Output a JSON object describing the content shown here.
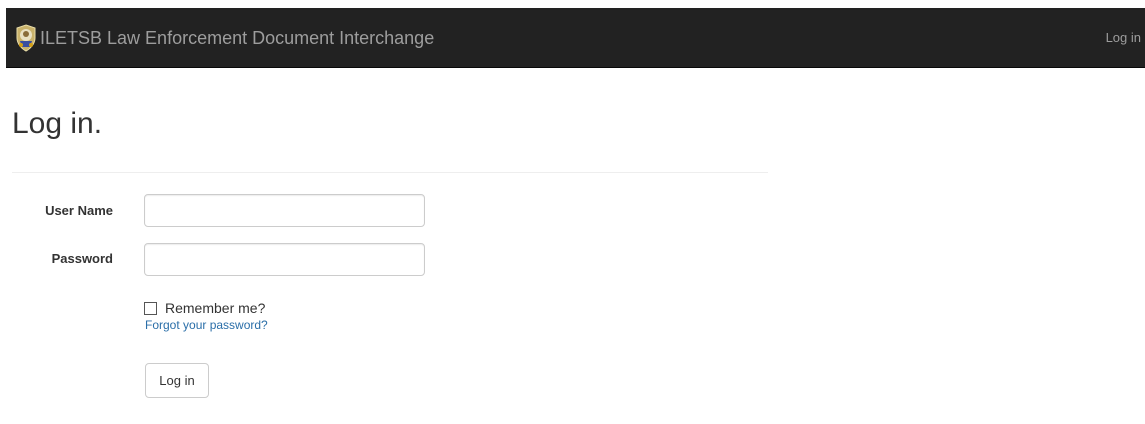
{
  "header": {
    "brand_text": "ILETSB Law Enforcement Document Interchange",
    "brand_icon": "law-enforcement-seal-icon",
    "login_link": "Log in",
    "background_color": "#222222",
    "text_color": "#9d9d9d"
  },
  "main": {
    "title": "Log in.",
    "form": {
      "username_label": "User Name",
      "username_value": "",
      "password_label": "Password",
      "password_value": "",
      "remember_label": "Remember me?",
      "remember_checked": false,
      "forgot_link": "Forgot your password?",
      "submit_label": "Log in"
    }
  },
  "colors": {
    "link": "#2a6ea8",
    "input_border": "#cccccc"
  }
}
